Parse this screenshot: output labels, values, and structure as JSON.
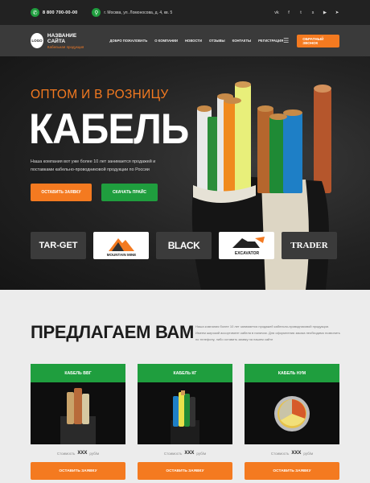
{
  "topbar": {
    "phone": "8 800 700-00-00",
    "address": "г. Москва, ул. Ломоносова, д. 4, кв. 5",
    "socials": [
      "vk-icon",
      "facebook-icon",
      "twitter-icon",
      "skype-icon",
      "youtube-icon",
      "telegram-icon"
    ]
  },
  "header": {
    "logo_text": "LOGO",
    "site_name": "НАЗВАНИЕ САЙТА",
    "tagline": "Кабельная продукция",
    "nav": [
      "ДОБРО ПОЖАЛОВАТЬ",
      "О КОМПАНИИ",
      "НОВОСТИ",
      "ОТЗЫВЫ",
      "КОНТАКТЫ",
      "РЕГИСТРАЦИЯ"
    ],
    "callback_label": "ОБРАТНЫЙ ЗВОНОК"
  },
  "hero": {
    "pretitle": "ОПТОМ И В РОЗНИЦУ",
    "title": "КАБЕЛЬ",
    "description": "Наша компания вот уже более 10 лет занимается продажей и поставками кабельно-проводниковой продукции по России",
    "btn_request": "ОСТАВИТЬ ЗАЯВКУ",
    "btn_price": "СКАЧАТЬ ПРАЙС",
    "partner_logos": [
      "TAR-GET",
      "MOUNTAIN MINE",
      "BLACK",
      "EXCAVATOR",
      "TRADER"
    ]
  },
  "offer": {
    "heading": "ПРЕДЛАГАЕМ ВАМ",
    "intro": "Наша компания более 10 лет занимается продажей кабельно-проводниковой продукции. Имеем широкий ассортимент кабеля в наличии. Для оформления заказа необходимо позвонить по телефону, либо оставить заявку на нашем сайте",
    "price_label": "Стоимость",
    "price_unit": "руб/м",
    "order_label": "ОСТАВИТЬ ЗАЯВКУ",
    "cards": [
      {
        "title": "КАБЕЛЬ ВВГ",
        "price": "XXX"
      },
      {
        "title": "КАБЕЛЬ КГ",
        "price": "XXX"
      },
      {
        "title": "КАБЕЛЬ НУМ",
        "price": "XXX"
      }
    ]
  },
  "colors": {
    "accent_orange": "#f47a20",
    "accent_green": "#1f9e3e"
  }
}
